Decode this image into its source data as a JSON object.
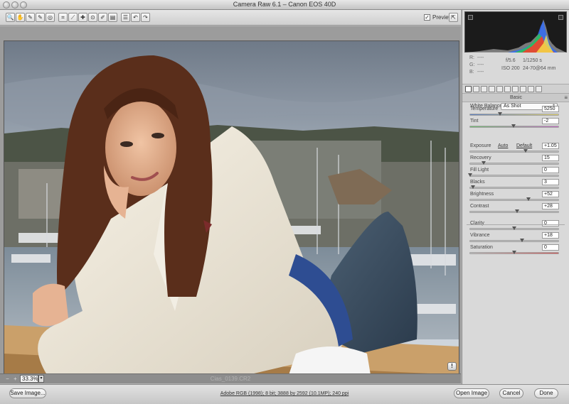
{
  "window": {
    "title": "Camera Raw 6.1  –  Canon EOS 40D"
  },
  "toolbar": {
    "tools": [
      {
        "icon": "zoom-icon",
        "glyph": "🔍"
      },
      {
        "icon": "hand-icon",
        "glyph": "✋"
      },
      {
        "icon": "white-balance-icon",
        "glyph": "✎"
      },
      {
        "icon": "color-sampler-icon",
        "glyph": "✎"
      },
      {
        "icon": "targeted-adjust-icon",
        "glyph": "◎"
      },
      {
        "icon": "crop-icon",
        "glyph": "⌗"
      },
      {
        "icon": "straighten-icon",
        "glyph": "⟋"
      },
      {
        "icon": "spot-removal-icon",
        "glyph": "✚"
      },
      {
        "icon": "red-eye-icon",
        "glyph": "⊙"
      },
      {
        "icon": "adjustment-brush-icon",
        "glyph": "✐"
      },
      {
        "icon": "graduated-filter-icon",
        "glyph": "▤"
      },
      {
        "icon": "preferences-icon",
        "glyph": "☰"
      },
      {
        "icon": "rotate-left-icon",
        "glyph": "↶"
      },
      {
        "icon": "rotate-right-icon",
        "glyph": "↷"
      }
    ],
    "preview_label": "Preview",
    "preview_checked": "✓",
    "fullscreen_glyph": "⇱"
  },
  "canvas": {
    "zoom_value": "33.3%",
    "zoom_minus": "−",
    "zoom_plus": "+",
    "zoom_arrow": "▾",
    "filename": "Cias_0139.CR2",
    "warning_glyph": "!"
  },
  "info": {
    "r_label": "R:",
    "g_label": "G:",
    "b_label": "B:",
    "r_value": "----",
    "g_value": "----",
    "b_value": "----",
    "aperture": "f/5.6",
    "shutter": "1/1250 s",
    "iso": "ISO 200",
    "lens": "24-70@64 mm"
  },
  "panel": {
    "section_title": "Basic",
    "section_menu": "≡",
    "white_balance_label": "White Balance:",
    "white_balance_value": "As Shot",
    "select_arrow": "⇕",
    "auto_label": "Auto",
    "default_label": "Default",
    "sliders": [
      {
        "label": "Temperature",
        "value": "5250",
        "pos": 0.34,
        "kind": "temp"
      },
      {
        "label": "Tint",
        "value": "-2",
        "pos": 0.49,
        "kind": "tint"
      },
      {
        "label": "Exposure",
        "value": "+1.05",
        "pos": 0.63,
        "kind": "plain"
      },
      {
        "label": "Recovery",
        "value": "15",
        "pos": 0.15,
        "kind": "plain"
      },
      {
        "label": "Fill Light",
        "value": "0",
        "pos": 0.0,
        "kind": "plain"
      },
      {
        "label": "Blacks",
        "value": "3",
        "pos": 0.03,
        "kind": "plain"
      },
      {
        "label": "Brightness",
        "value": "+52",
        "pos": 0.66,
        "kind": "plain"
      },
      {
        "label": "Contrast",
        "value": "+28",
        "pos": 0.53,
        "kind": "plain"
      },
      {
        "label": "Clarity",
        "value": "0",
        "pos": 0.5,
        "kind": "plain"
      },
      {
        "label": "Vibrance",
        "value": "+18",
        "pos": 0.59,
        "kind": "plain"
      },
      {
        "label": "Saturation",
        "value": "0",
        "pos": 0.5,
        "kind": "sat"
      }
    ]
  },
  "bottom": {
    "save_image": "Save Image...",
    "workflow_options": "Adobe RGB (1998); 8 bit; 3888 by 2592 (10.1MP); 240 ppi",
    "open_image": "Open Image",
    "cancel": "Cancel",
    "done": "Done"
  },
  "colors": {
    "panel_bg": "#d9d9d9",
    "canvas_bg": "#9c9c9c",
    "histogram_bg": "#1b1b1b"
  }
}
